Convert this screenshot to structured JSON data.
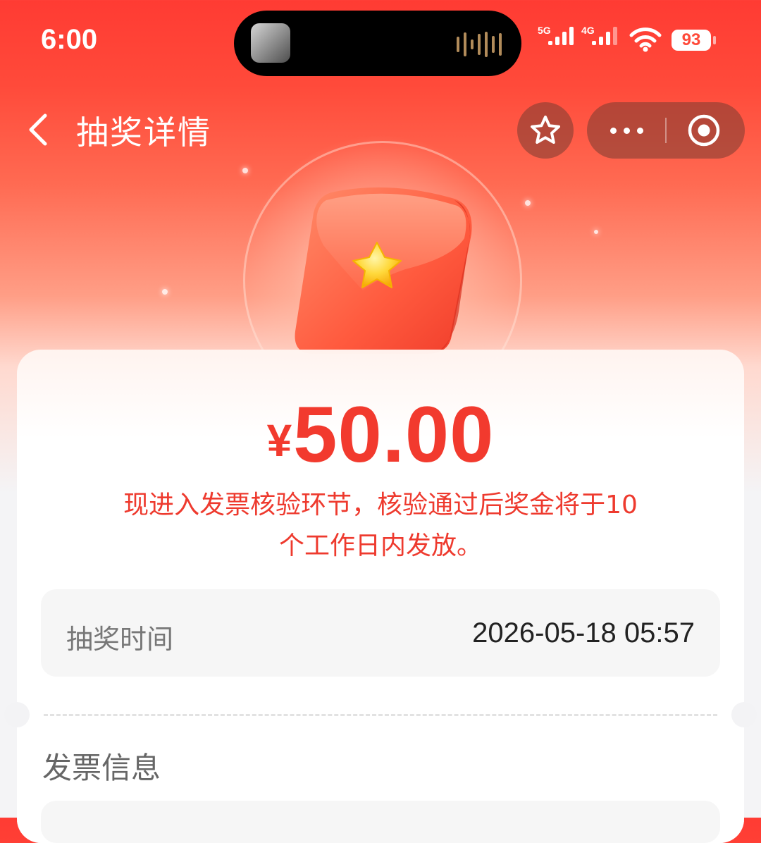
{
  "status_bar": {
    "time": "6:00",
    "signal_1_label": "5G",
    "signal_2_label": "4G",
    "battery": "93"
  },
  "nav": {
    "title": "抽奖详情",
    "back_icon": "chevron-left-icon",
    "favorite_icon": "star-icon",
    "more_icon": "more-dots-icon",
    "close_icon": "target-close-icon"
  },
  "prize": {
    "currency": "¥",
    "amount": "50.00",
    "notice_line1": "现进入发票核验环节，核验通过后奖金将于10",
    "notice_line2": "个工作日内发放。"
  },
  "draw_info": {
    "label": "抽奖时间",
    "value": "2026-05-18 05:57"
  },
  "invoice_section": {
    "title": "发票信息"
  },
  "colors": {
    "accent": "#f23a2e",
    "header_red": "#ff3b33"
  }
}
